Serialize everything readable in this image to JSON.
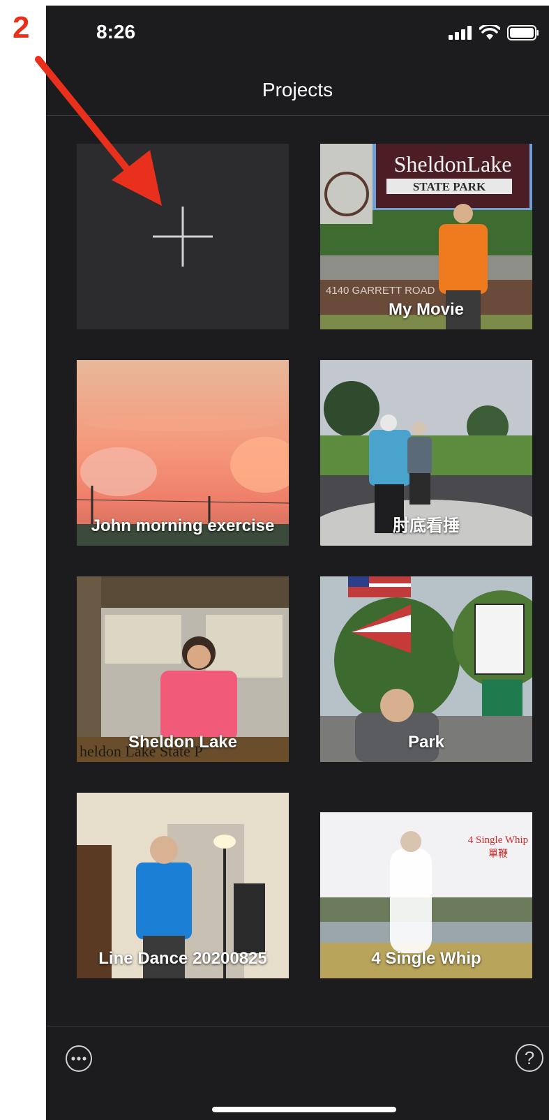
{
  "annotation": {
    "step_number": "2",
    "color": "#e8301c"
  },
  "status_bar": {
    "time": "8:26",
    "signal_icon": "cellular-signal-icon",
    "wifi_icon": "wifi-icon",
    "battery_icon": "battery-icon"
  },
  "nav": {
    "title": "Projects"
  },
  "new_project": {
    "icon": "plus-icon"
  },
  "projects": [
    {
      "title": "My Movie",
      "sign_text": "SheldonLake",
      "sign_sub": "STATE PARK",
      "road_text": "4140 GARRETT ROAD"
    },
    {
      "title": "John morning exercise"
    },
    {
      "title": "肘底看捶"
    },
    {
      "title": "Sheldon Lake",
      "board_text": "heldon Lake State P"
    },
    {
      "title": "Park"
    },
    {
      "title": "Line Dance 20200825"
    },
    {
      "title": "4 Single Whip",
      "overlay_text": "4 Single Whip",
      "overlay_sub": "單鞭"
    }
  ],
  "toolbar": {
    "more_icon": "ellipsis-circle-icon",
    "help_label": "?",
    "help_icon": "question-circle-icon"
  },
  "colors": {
    "background": "#1c1c1e",
    "tile": "#2c2c2e",
    "annotation": "#e8301c"
  }
}
